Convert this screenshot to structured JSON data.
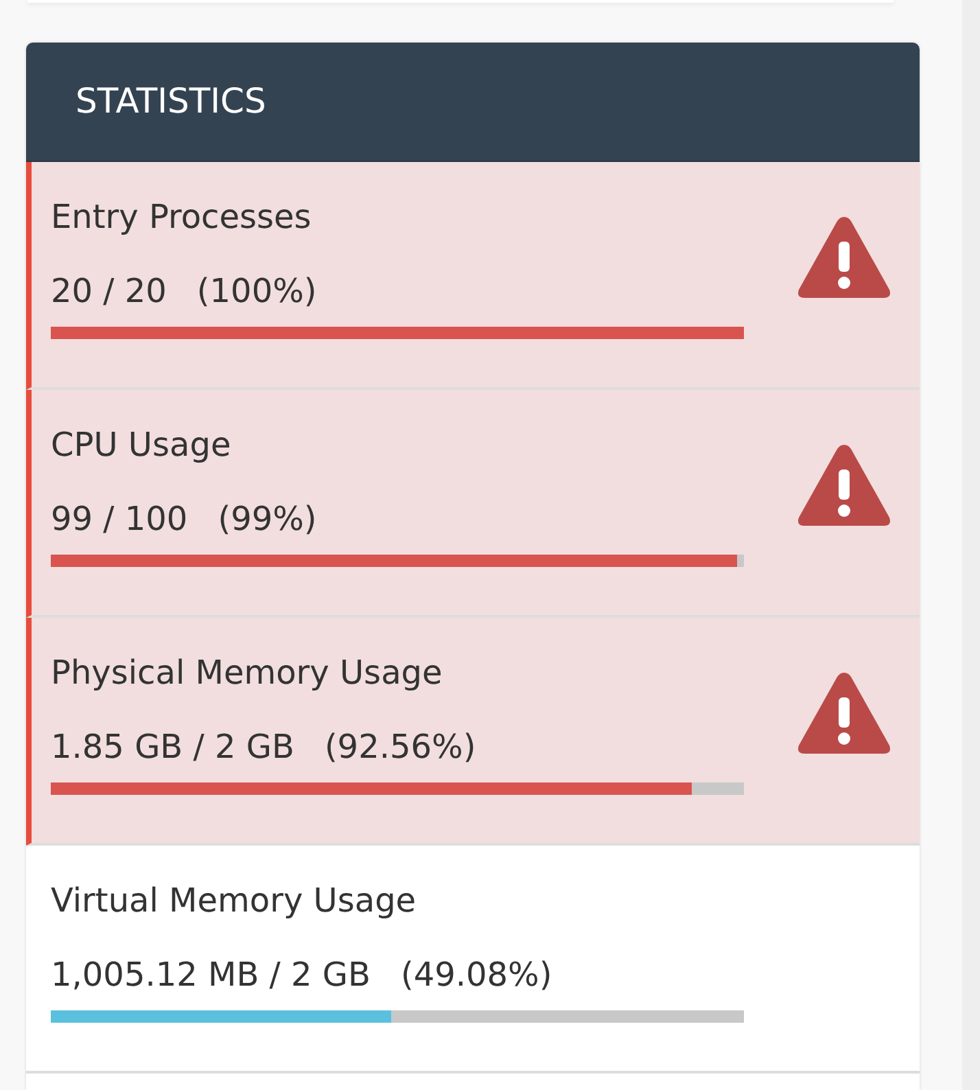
{
  "panel": {
    "title": "STATISTICS"
  },
  "stats": [
    {
      "label": "Entry Processes",
      "usage": "20 / 20",
      "percent": "(100%)",
      "level": 1.0,
      "alert": true
    },
    {
      "label": "CPU Usage",
      "usage": "99 / 100",
      "percent": "(99%)",
      "level": 0.99,
      "alert": true
    },
    {
      "label": "Physical Memory Usage",
      "usage": "1.85 GB / 2 GB",
      "percent": "(92.56%)",
      "level": 0.9256,
      "alert": true
    },
    {
      "label": "Virtual Memory Usage",
      "usage": "1,005.12 MB / 2 GB",
      "percent": "(49.08%)",
      "level": 0.4908,
      "alert": false
    }
  ]
}
